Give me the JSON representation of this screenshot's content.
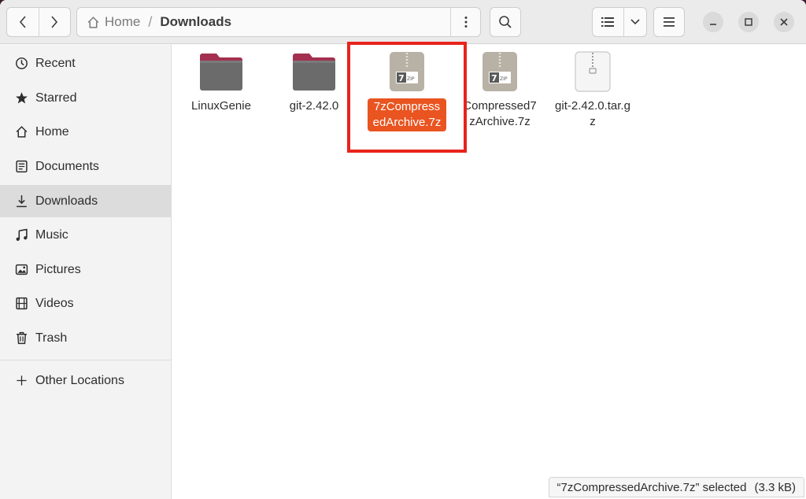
{
  "breadcrumb": {
    "home": "Home",
    "separator": "/",
    "current": "Downloads"
  },
  "sidebar": {
    "items": [
      {
        "label": "Recent",
        "icon": "clock-icon"
      },
      {
        "label": "Starred",
        "icon": "star-icon"
      },
      {
        "label": "Home",
        "icon": "home-icon"
      },
      {
        "label": "Documents",
        "icon": "document-icon"
      },
      {
        "label": "Downloads",
        "icon": "download-icon",
        "active": true
      },
      {
        "label": "Music",
        "icon": "music-note-icon"
      },
      {
        "label": "Pictures",
        "icon": "picture-icon"
      },
      {
        "label": "Videos",
        "icon": "video-icon"
      },
      {
        "label": "Trash",
        "icon": "trash-icon"
      }
    ],
    "other_locations": "Other Locations"
  },
  "files": [
    {
      "name": "LinuxGenie",
      "type": "folder"
    },
    {
      "name": "git-2.42.0",
      "type": "folder"
    },
    {
      "name": "7zCompressedArchive.7z",
      "type": "7z-archive",
      "selected": true
    },
    {
      "name": "Compressed7zArchive.7z",
      "type": "7z-archive"
    },
    {
      "name": "git-2.42.0.tar.gz",
      "type": "tar-archive"
    }
  ],
  "status": {
    "selected": "“7zCompressedArchive.7z” selected",
    "size": "(3.3 kB)"
  },
  "colors": {
    "accent": "#e95420",
    "highlight": "#e8231c",
    "folder": "#6b6b6b",
    "folder_tab": "#a3304f"
  }
}
